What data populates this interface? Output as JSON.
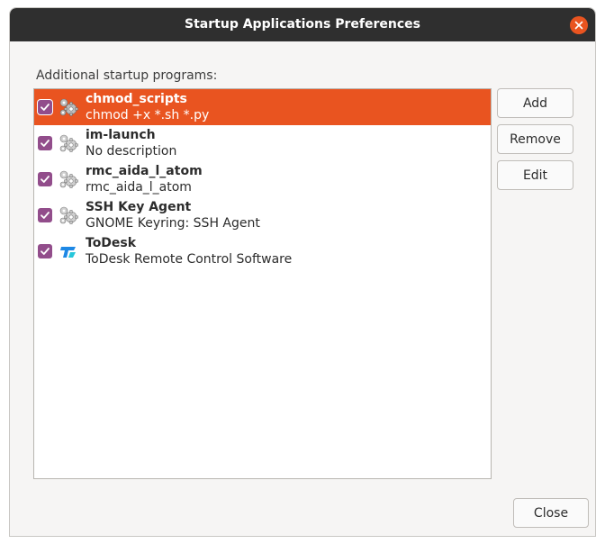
{
  "window": {
    "title": "Startup Applications Preferences"
  },
  "section_label": "Additional startup programs:",
  "programs": [
    {
      "name": "chmod_scripts",
      "description": "chmod +x *.sh *.py",
      "enabled": true,
      "selected": true,
      "icon": "gears-icon"
    },
    {
      "name": "im-launch",
      "description": "No description",
      "enabled": true,
      "selected": false,
      "icon": "gears-icon"
    },
    {
      "name": "rmc_aida_l_atom",
      "description": "rmc_aida_l_atom",
      "enabled": true,
      "selected": false,
      "icon": "gears-icon"
    },
    {
      "name": "SSH Key Agent",
      "description": "GNOME Keyring: SSH Agent",
      "enabled": true,
      "selected": false,
      "icon": "gears-icon"
    },
    {
      "name": "ToDesk",
      "description": "ToDesk Remote Control Software",
      "enabled": true,
      "selected": false,
      "icon": "todesk-icon"
    }
  ],
  "buttons": {
    "add": "Add",
    "remove": "Remove",
    "edit": "Edit",
    "close": "Close"
  },
  "colors": {
    "accent": "#e95420",
    "checkbox": "#924d8b",
    "titlebar": "#2f2f2f"
  }
}
